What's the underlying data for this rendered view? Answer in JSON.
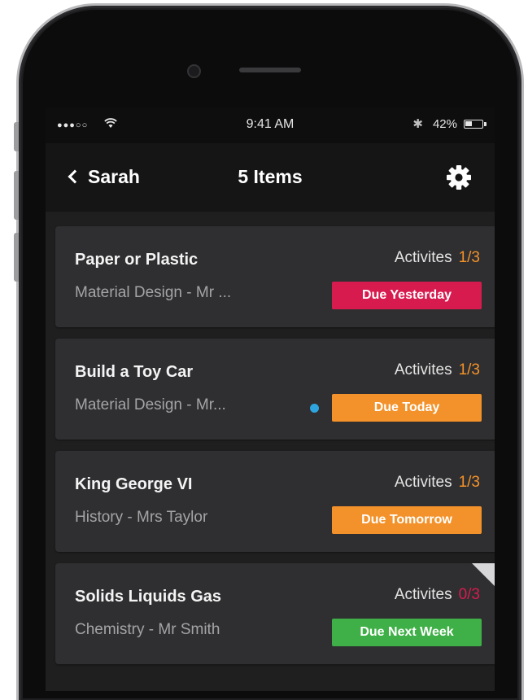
{
  "statusbar": {
    "signal": "●●●○○",
    "time": "9:41 AM",
    "bluetooth": "✱",
    "battery_pct": "42%",
    "battery_level": 0.42,
    "wifi_icon": "wifi-icon",
    "battery_icon": "battery-icon"
  },
  "navbar": {
    "back_label": "Sarah",
    "title": "5 Items",
    "settings_icon": "gear-icon"
  },
  "colors": {
    "due_yesterday": "#d81b4f",
    "due_today": "#f3922a",
    "due_tomorrow": "#f3922a",
    "due_next_week": "#3fb047",
    "activity_count": "#f3922a",
    "activity_count_alert": "#d81b4f",
    "unread_dot": "#2ea5e0"
  },
  "items": [
    {
      "title": "Paper or Plastic",
      "subtitle": "Material Design - Mr ...",
      "activities_label": "Activites",
      "activities_count": "1/3",
      "due_label": "Due Yesterday"
    },
    {
      "title": "Build a Toy Car",
      "subtitle": "Material Design - Mr...",
      "activities_label": "Activites",
      "activities_count": "1/3",
      "due_label": "Due Today",
      "unread": true
    },
    {
      "title": "King George VI",
      "subtitle": "History - Mrs Taylor",
      "activities_label": "Activites",
      "activities_count": "1/3",
      "due_label": "Due Tomorrow"
    },
    {
      "title": "Solids Liquids Gas",
      "subtitle": "Chemistry - Mr Smith",
      "activities_label": "Activites",
      "activities_count": "0/3",
      "due_label": "Due Next Week",
      "corner_fold": true
    }
  ]
}
